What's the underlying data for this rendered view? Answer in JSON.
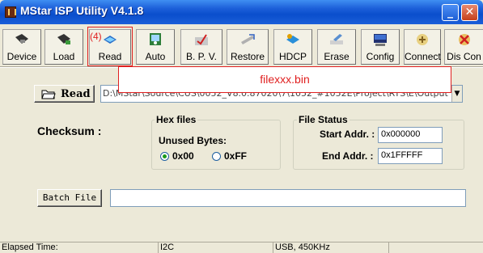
{
  "window": {
    "title": "MStar ISP Utility V4.1.8",
    "minimize_glyph": "_",
    "close_glyph": "✕"
  },
  "toolbar": {
    "buttons": [
      {
        "label": "Device",
        "icon": "device-icon"
      },
      {
        "label": "Load",
        "icon": "load-icon"
      },
      {
        "label": "Read",
        "icon": "read-icon"
      },
      {
        "label": "Auto",
        "icon": "auto-icon"
      },
      {
        "label": "B. P. V.",
        "icon": "bpv-icon"
      },
      {
        "label": "Restore",
        "icon": "restore-icon"
      },
      {
        "label": "HDCP",
        "icon": "hdcp-icon"
      },
      {
        "label": "Erase",
        "icon": "erase-icon"
      },
      {
        "label": "Config",
        "icon": "config-icon"
      },
      {
        "label": "Connect",
        "icon": "connect-icon"
      },
      {
        "label": "Dis Con",
        "icon": "disconnect-icon"
      }
    ]
  },
  "annotation": {
    "step": "(4)",
    "filename": "filexxx.bin",
    "color": "#e02020"
  },
  "read_panel": {
    "read_label": "Read",
    "path": "D:\\MStar\\Source\\CUS\\0052_V8.0.87020\\7\\1052_#1052E\\Project\\RTS\\E\\Output"
  },
  "checksum": {
    "label": "Checksum :"
  },
  "hex_files": {
    "title": "Hex files",
    "unused_label": "Unused Bytes:",
    "options": [
      "0x00",
      "0xFF"
    ],
    "selected": "0x00"
  },
  "file_status": {
    "title": "File Status",
    "start_label": "Start Addr. :",
    "start_value": "0x000000",
    "end_label": "End Addr. :",
    "end_value": "0x1FFFFF"
  },
  "batch": {
    "button_label": "Batch File",
    "value": ""
  },
  "status_bar": {
    "elapsed": "Elapsed Time:",
    "interface": "I2C",
    "speed": "USB, 450KHz"
  }
}
